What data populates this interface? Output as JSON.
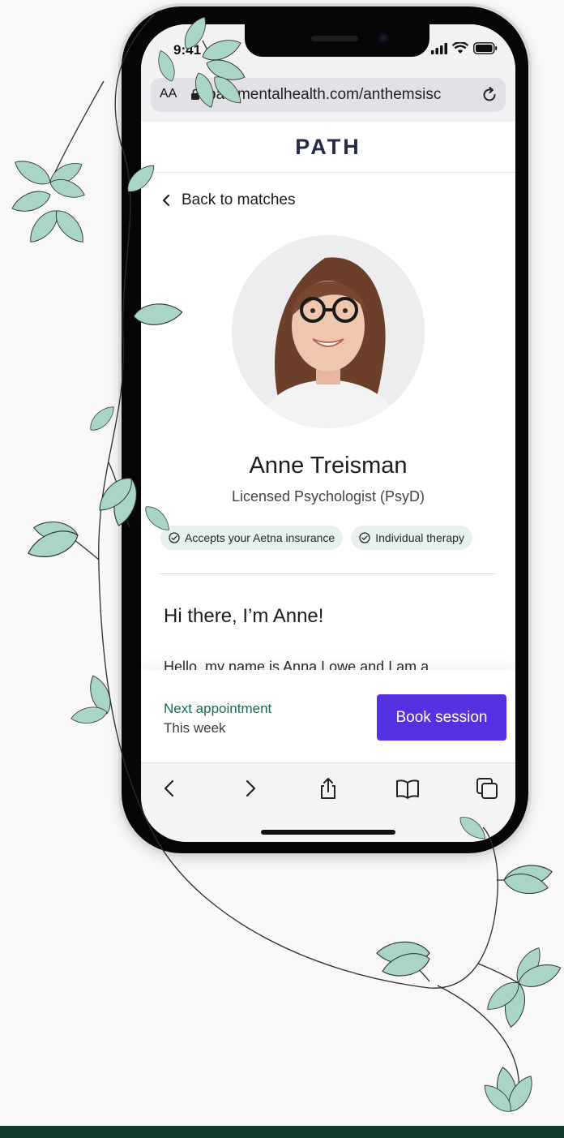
{
  "status": {
    "time": "9:41"
  },
  "browser": {
    "text_size_label": "AA",
    "url": "pathmentalhealth.com/anthemsisc"
  },
  "header": {
    "logo": "PATH"
  },
  "profile": {
    "back_label": "Back to matches",
    "name": "Anne Treisman",
    "title": "Licensed Psychologist (PsyD)",
    "chips": [
      "Accepts your Aetna insurance",
      "Individual therapy"
    ],
    "greeting": "Hi there, I’m Anne!",
    "bio_preview": "Hello, my name is Anna Lowe and I am a"
  },
  "cta": {
    "next_label": "Next appointment",
    "next_value": "This week",
    "book_label": "Book session"
  },
  "colors": {
    "accent": "#5631e2",
    "brand_dark": "#0e3b2c",
    "chip_bg": "#e8f1ed",
    "leaf": "#a9d5c4"
  },
  "icons": [
    "back-chevron-icon",
    "check-circle-icon",
    "lock-icon",
    "reload-icon",
    "share-icon",
    "bookmarks-icon",
    "tabs-icon",
    "signal-icon",
    "wifi-icon",
    "battery-icon"
  ]
}
